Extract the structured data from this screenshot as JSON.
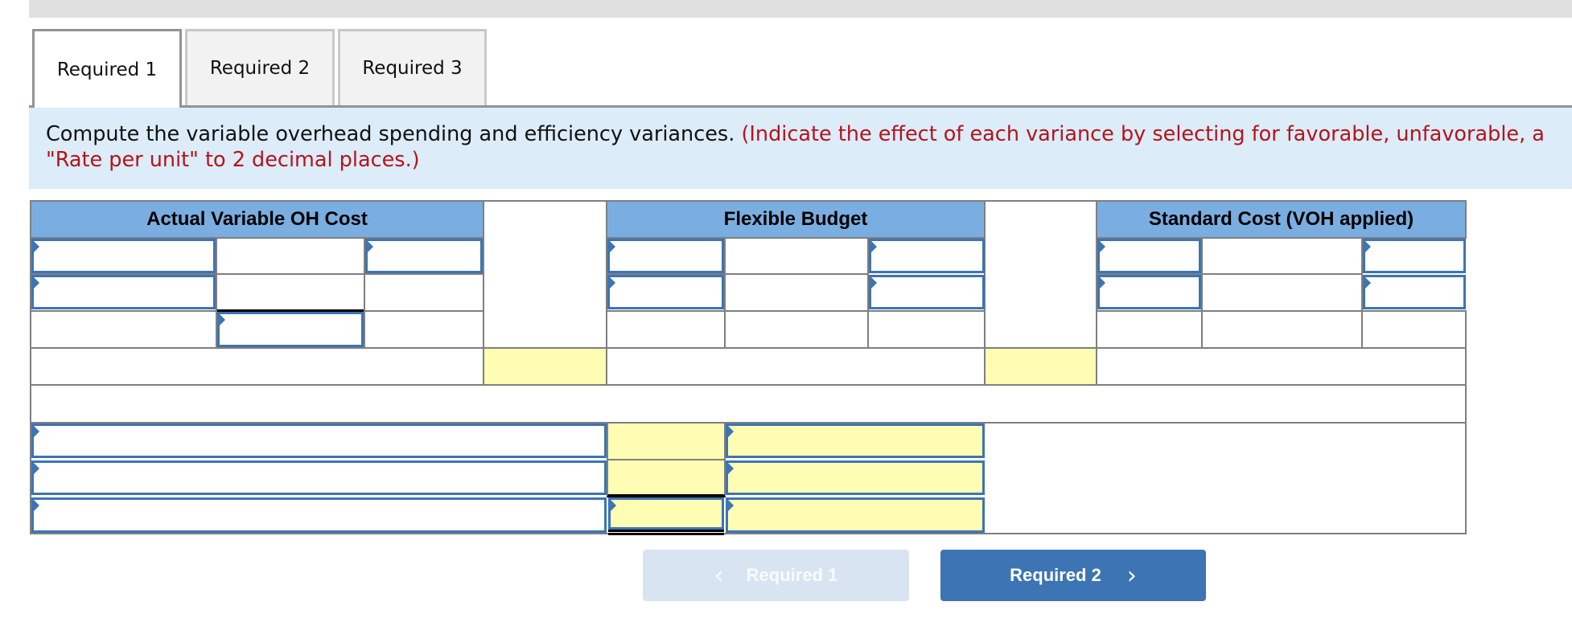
{
  "tabs": [
    {
      "label": "Required 1",
      "active": true
    },
    {
      "label": "Required 2",
      "active": false
    },
    {
      "label": "Required 3",
      "active": false
    }
  ],
  "instructions": {
    "main": "Compute the variable overhead spending and efficiency variances.",
    "note_line1": "(Indicate the effect of each variance by selecting for favorable, unfavorable, a",
    "note_line2": "\"Rate per unit\" to 2 decimal places.)"
  },
  "table": {
    "headers": {
      "actual": "Actual Variable OH Cost",
      "flexible": "Flexible Budget",
      "standard": "Standard Cost (VOH applied)"
    },
    "cells_empty": true
  },
  "colors": {
    "header_bg": "#7aaee1",
    "input_border": "#3d74b4",
    "answer_yellow": "#fffdb3",
    "instruction_red": "#b3141c",
    "instruction_bg": "#dcecf8"
  },
  "nav": {
    "prev_label": "Required 1",
    "next_label": "Required 2",
    "prev_icon": "chevron-left-icon",
    "next_icon": "chevron-right-icon"
  }
}
